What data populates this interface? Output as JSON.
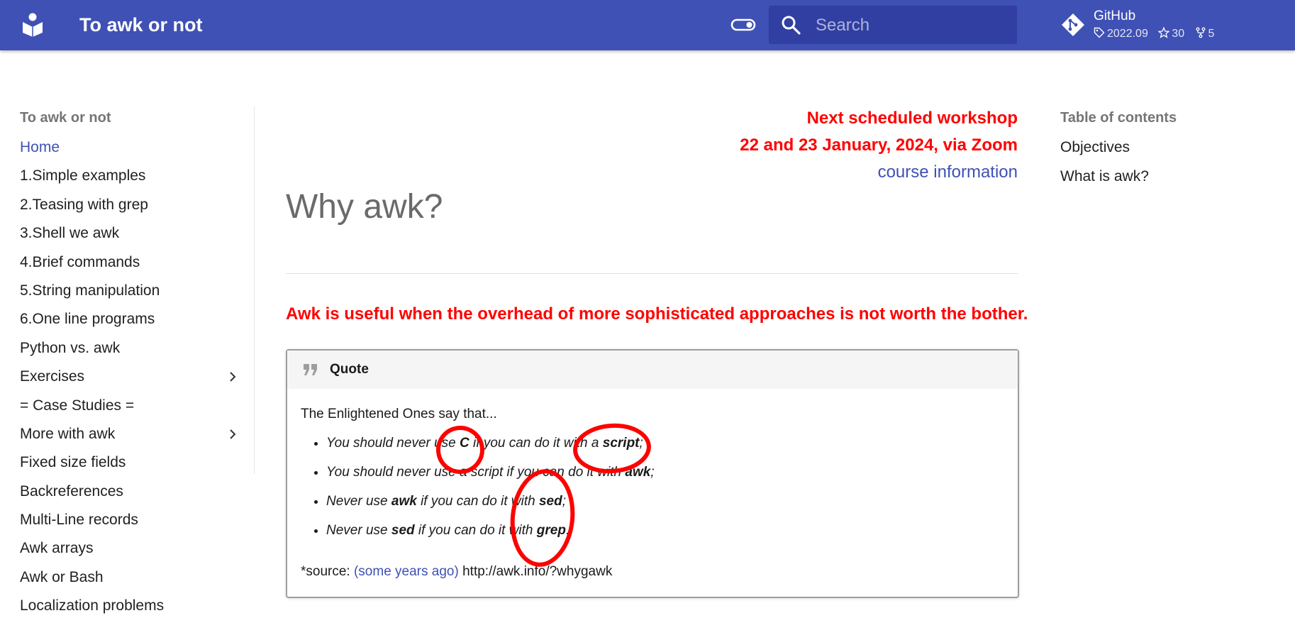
{
  "header": {
    "site_title": "To awk or not",
    "search_placeholder": "Search",
    "repo": {
      "name": "GitHub",
      "version": "2022.09",
      "stars": "30",
      "forks": "5"
    },
    "accent": "#3f51b5"
  },
  "nav": {
    "title": "To awk or not",
    "items": [
      {
        "label": "Home",
        "active": true
      },
      {
        "label": "1.Simple examples"
      },
      {
        "label": "2.Teasing with grep"
      },
      {
        "label": "3.Shell we awk"
      },
      {
        "label": "4.Brief commands"
      },
      {
        "label": "5.String manipulation"
      },
      {
        "label": "6.One line programs"
      },
      {
        "label": "Python vs. awk"
      },
      {
        "label": "Exercises",
        "expandable": true
      },
      {
        "label": "= Case Studies ="
      },
      {
        "label": "More with awk",
        "expandable": true
      },
      {
        "label": "Fixed size fields"
      },
      {
        "label": "Backreferences"
      },
      {
        "label": "Multi-Line records"
      },
      {
        "label": "Awk arrays"
      },
      {
        "label": "Awk or Bash"
      },
      {
        "label": "Localization problems"
      }
    ]
  },
  "content": {
    "announce_line1": "Next scheduled workshop",
    "announce_line2": "22 and 23 January, 2024, via Zoom",
    "announce_link": "course information",
    "heading": "Why awk?",
    "lead": "Awk is useful when the overhead of more sophisticated approaches is not worth the bother.",
    "quote": {
      "title": "Quote",
      "intro": "The Enlightened Ones say that...",
      "items": [
        {
          "t1": "You should never use ",
          "b1": "C",
          "t2": " if you can do it with a ",
          "b2": "script",
          "t3": ";"
        },
        {
          "t1": "You should never use a script if you can do it with ",
          "b1": "awk",
          "t2": ";",
          "b2": "",
          "t3": ""
        },
        {
          "t1": "Never use ",
          "b1": "awk",
          "t2": " if you can do it with ",
          "b2": "sed",
          "t3": ";"
        },
        {
          "t1": "Never use ",
          "b1": "sed",
          "t2": " if you can do it with ",
          "b2": "grep",
          "t3": "."
        }
      ],
      "source_prefix": "*source: ",
      "source_link": "(some years ago)",
      "source_url": " http://awk.info/?whygawk"
    },
    "announce_color": "#ff0000",
    "annotation_color": "#ff0000"
  },
  "toc": {
    "title": "Table of contents",
    "items": [
      {
        "label": "Objectives"
      },
      {
        "label": "What is awk?"
      }
    ]
  }
}
